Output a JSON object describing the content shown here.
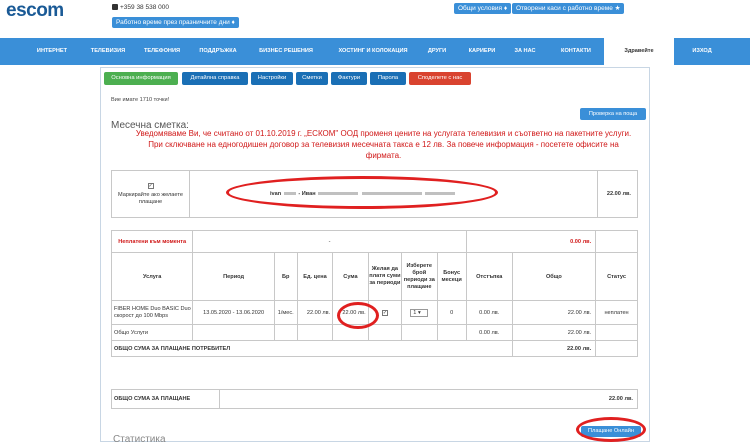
{
  "header": {
    "logo": "escom",
    "phone": "+359 38 538 000",
    "hours_label": "Работно време през празничните дни",
    "terms_label": "Общи условия",
    "open_offices_label": "Отворени каси с работно време"
  },
  "nav": {
    "items": [
      "ИНТЕРНЕТ",
      "ТЕЛЕВИЗИЯ",
      "ТЕЛЕФОНИЯ",
      "ПОДДРЪЖКА",
      "БИЗНЕС РЕШЕНИЯ",
      "ХОСТИНГ И КОЛОКАЦИЯ",
      "ДРУГИ",
      "КАРИЕРИ",
      "ЗА НАС",
      "КОНТАКТИ"
    ],
    "greeting": "Здравейте",
    "logout": "ИЗХОД"
  },
  "tabs": [
    {
      "label": "Основна информация",
      "color": "#4caf50"
    },
    {
      "label": "Детайлна справка",
      "color": "#1a6fb5"
    },
    {
      "label": "Настройки",
      "color": "#1a6fb5"
    },
    {
      "label": "Сметки",
      "color": "#1a6fb5"
    },
    {
      "label": "Фактури",
      "color": "#1a6fb5"
    },
    {
      "label": "Парола",
      "color": "#1a6fb5"
    },
    {
      "label": "Споделете с нас",
      "color": "#d9432f"
    }
  ],
  "account": {
    "points": "Вие имате 1710 точки!",
    "check_mail": "Проверка на поща",
    "monthly_title": "Месечна сметка:",
    "notice": "Уведомяваме Ви, че считано от 01.10.2019 г. „ЕСКОМ\" ООД променя цените на услугата телевизия и съответно на пакетните услуги. При сключване на едногодишен договор за телевизия месечната такса е 12 лв. За повече информация - посетете офисите на фирмата."
  },
  "summary": {
    "mark_label": "Маркирайте ако желаете плащане",
    "name_a": "ivan",
    "name_b": "- Иван",
    "amount": "22.00 лв."
  },
  "bill": {
    "unpaid_label": "Неплатени към момента",
    "unpaid_dash": "-",
    "unpaid_amount": "0.00 лв.",
    "columns": [
      "Услуга",
      "Период",
      "Бр",
      "Ед. цена",
      "Сума",
      "Желая да платя суми за периоди",
      "Изберете брой периоди за плащане",
      "Бонус месеци",
      "Отстъпка",
      "Общо",
      "Статус"
    ],
    "row": {
      "service": "FIBER HOME Duo BASIC Duo скорост до 100 Mbps",
      "period": "13.05.2020 - 13.06.2020",
      "qty": "1/мес.",
      "unit_price": "22.00 лв.",
      "sum": "22.00 лв.",
      "periods": "1",
      "bonus": "0",
      "discount": "0.00 лв.",
      "total": "22.00 лв.",
      "status": "неплатен"
    },
    "general": {
      "label": "Общо Услуги",
      "discount": "0.00 лв.",
      "total": "22.00 лв."
    },
    "consumer_total_label": "ОБЩО СУМА ЗА ПЛАЩАНЕ ПОТРЕБИТЕЛ",
    "consumer_total": "22.00 лв."
  },
  "grand": {
    "label": "ОБЩО СУМА ЗА ПЛАЩАНЕ",
    "amount": "22.00 лв."
  },
  "pay_online": "Плащане Онлайн",
  "stats_title": "Статистика"
}
